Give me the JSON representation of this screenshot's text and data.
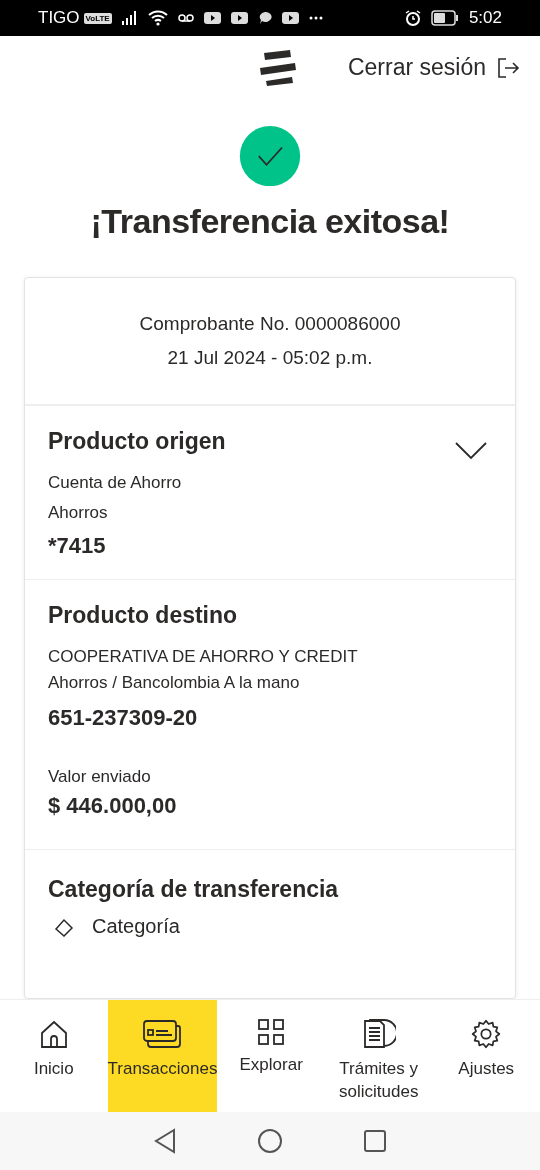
{
  "status_bar": {
    "carrier": "TIGO",
    "volte": "VoLTE",
    "time": "5:02"
  },
  "header": {
    "logout": "Cerrar sesión"
  },
  "title": "¡Transferencia exitosa!",
  "receipt": {
    "number": "Comprobante No. 0000086000",
    "date": "21 Jul 2024 - 05:02 p.m."
  },
  "origin": {
    "title": "Producto origen",
    "lines": [
      "Cuenta de Ahorro",
      "Ahorros"
    ],
    "account": "*7415"
  },
  "destination": {
    "title": "Producto destino",
    "lines": [
      "COOPERATIVA DE AHORRO Y CREDIT",
      "Ahorros / Bancolombia A la mano"
    ],
    "account": "651-237309-20",
    "amount_label": "Valor enviado",
    "amount": "$ 446.000,00"
  },
  "category": {
    "title": "Categoría de transferencia",
    "item": "Categoría"
  },
  "nav": [
    {
      "label": "Inicio",
      "selected": false
    },
    {
      "label": "Transacciones",
      "selected": true
    },
    {
      "label": "Explorar",
      "selected": false
    },
    {
      "label": "Trámites y solicitudes",
      "selected": false
    },
    {
      "label": "Ajustes",
      "selected": false
    }
  ]
}
